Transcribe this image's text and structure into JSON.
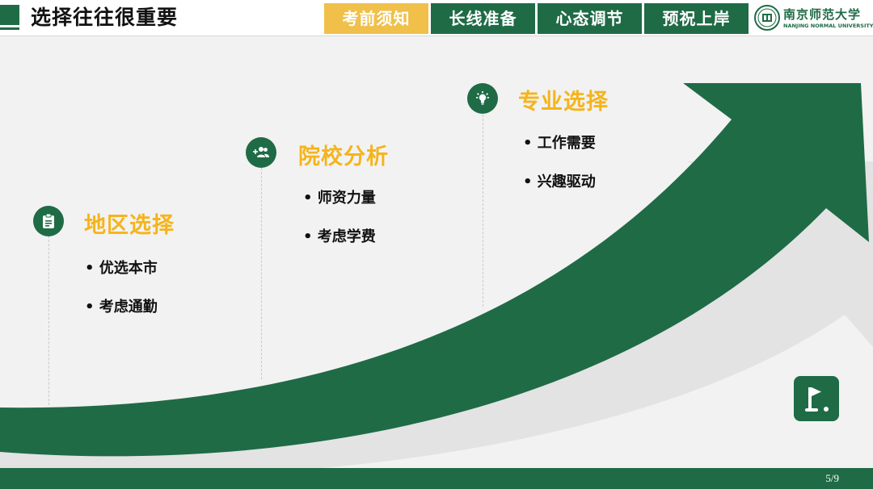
{
  "header": {
    "title": "选择往往很重要",
    "tabs": [
      {
        "label": "考前须知",
        "active": true
      },
      {
        "label": "长线准备",
        "active": false
      },
      {
        "label": "心态调节",
        "active": false
      },
      {
        "label": "预祝上岸",
        "active": false
      }
    ],
    "logo": {
      "name_cn": "南京师范大学",
      "name_en": "NANJING NORMAL UNIVERSITY"
    }
  },
  "sections": [
    {
      "heading": "地区选择",
      "icon": "clipboard-icon",
      "items": [
        "优选本市",
        "考虑通勤"
      ]
    },
    {
      "heading": "院校分析",
      "icon": "add-people-icon",
      "items": [
        "师资力量",
        "考虑学费"
      ]
    },
    {
      "heading": "专业选择",
      "icon": "lightbulb-icon",
      "items": [
        "工作需要",
        "兴趣驱动"
      ]
    }
  ],
  "footer": {
    "page": "5/9"
  },
  "colors": {
    "primary": "#1f6b46",
    "accent": "#f5b41b",
    "tab_active": "#f0c04a",
    "background": "#f2f2f2"
  },
  "icons": {
    "corner": "golf-flag-icon"
  }
}
